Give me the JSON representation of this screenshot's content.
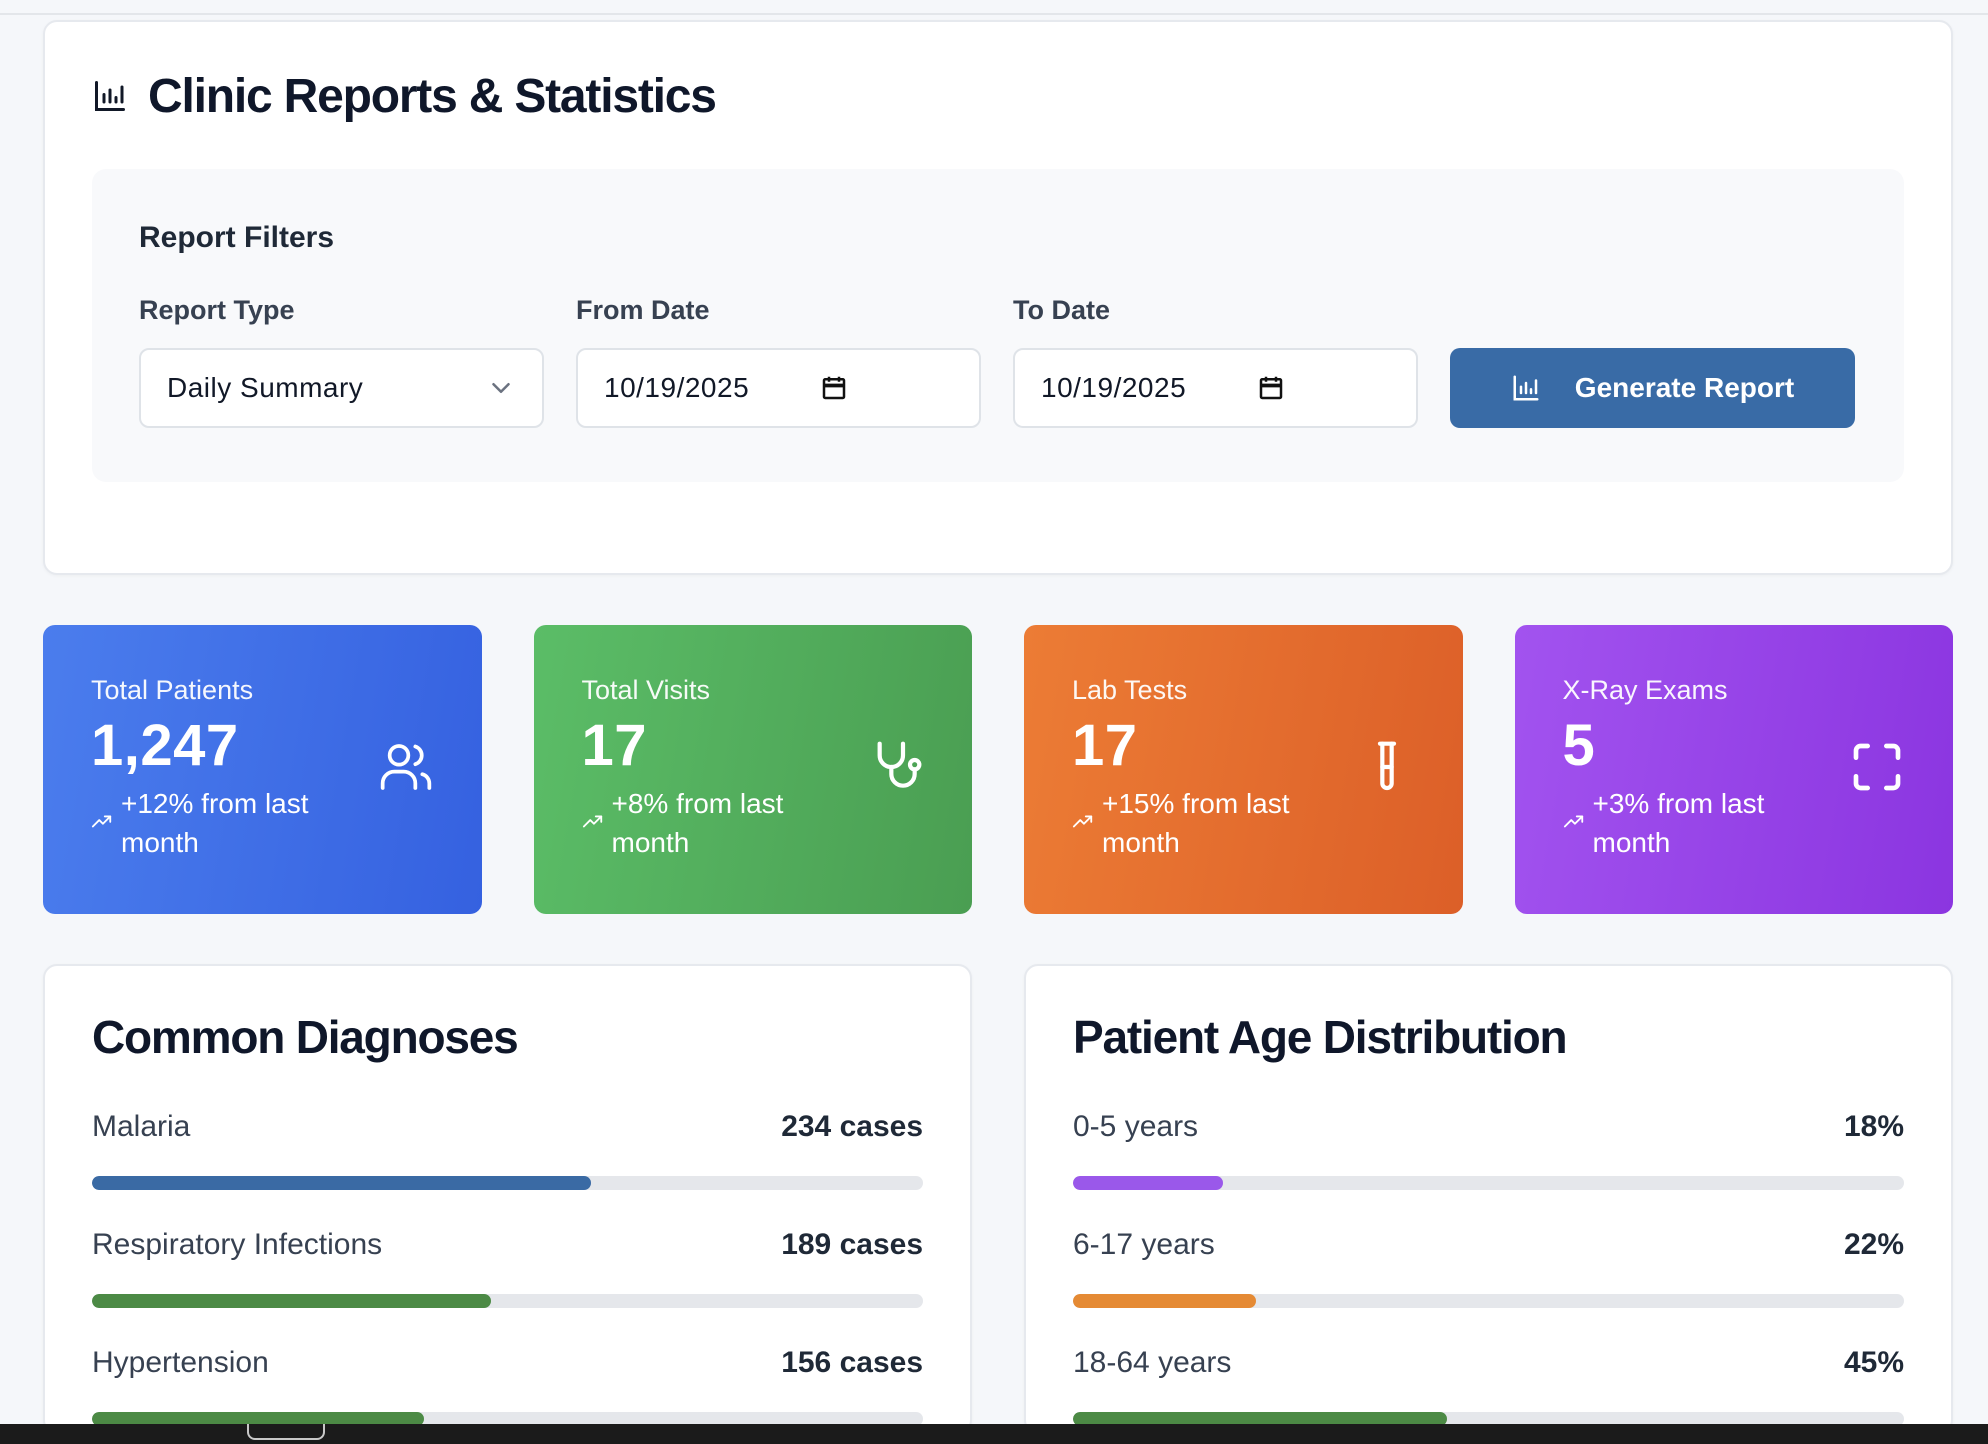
{
  "header": {
    "title": "Clinic Reports & Statistics",
    "icon": "bar-chart-icon"
  },
  "filters": {
    "title": "Report Filters",
    "report_type": {
      "label": "Report Type",
      "value": "Daily Summary"
    },
    "from_date": {
      "label": "From Date",
      "value": "10/19/2025"
    },
    "to_date": {
      "label": "To Date",
      "value": "10/19/2025"
    },
    "generate_label": "Generate Report"
  },
  "stats": [
    {
      "label": "Total Patients",
      "value": "1,247",
      "change": "+12% from last month",
      "icon": "users-icon",
      "color": "#3f6fe6"
    },
    {
      "label": "Total Visits",
      "value": "17",
      "change": "+8% from last month",
      "icon": "stethoscope-icon",
      "color": "#52ad5c"
    },
    {
      "label": "Lab Tests",
      "value": "17",
      "change": "+15% from last month",
      "icon": "test-tube-icon",
      "color": "#e46d2f"
    },
    {
      "label": "X-Ray Exams",
      "value": "5",
      "change": "+3% from last month",
      "icon": "scan-icon",
      "color": "#9644e8"
    }
  ],
  "diagnoses": {
    "title": "Common Diagnoses",
    "items": [
      {
        "name": "Malaria",
        "value": "234 cases",
        "fraction": 0.6,
        "color": "#3a6aa4"
      },
      {
        "name": "Respiratory Infections",
        "value": "189 cases",
        "fraction": 0.48,
        "color": "#4c8a45"
      },
      {
        "name": "Hypertension",
        "value": "156 cases",
        "fraction": 0.4,
        "color": "#4c8a45"
      }
    ]
  },
  "age_distribution": {
    "title": "Patient Age Distribution",
    "items": [
      {
        "name": "0-5 years",
        "value": "18%",
        "fraction": 0.18,
        "color": "#9a58ea"
      },
      {
        "name": "6-17 years",
        "value": "22%",
        "fraction": 0.22,
        "color": "#e58a34"
      },
      {
        "name": "18-64 years",
        "value": "45%",
        "fraction": 0.45,
        "color": "#4c8a45"
      }
    ]
  }
}
